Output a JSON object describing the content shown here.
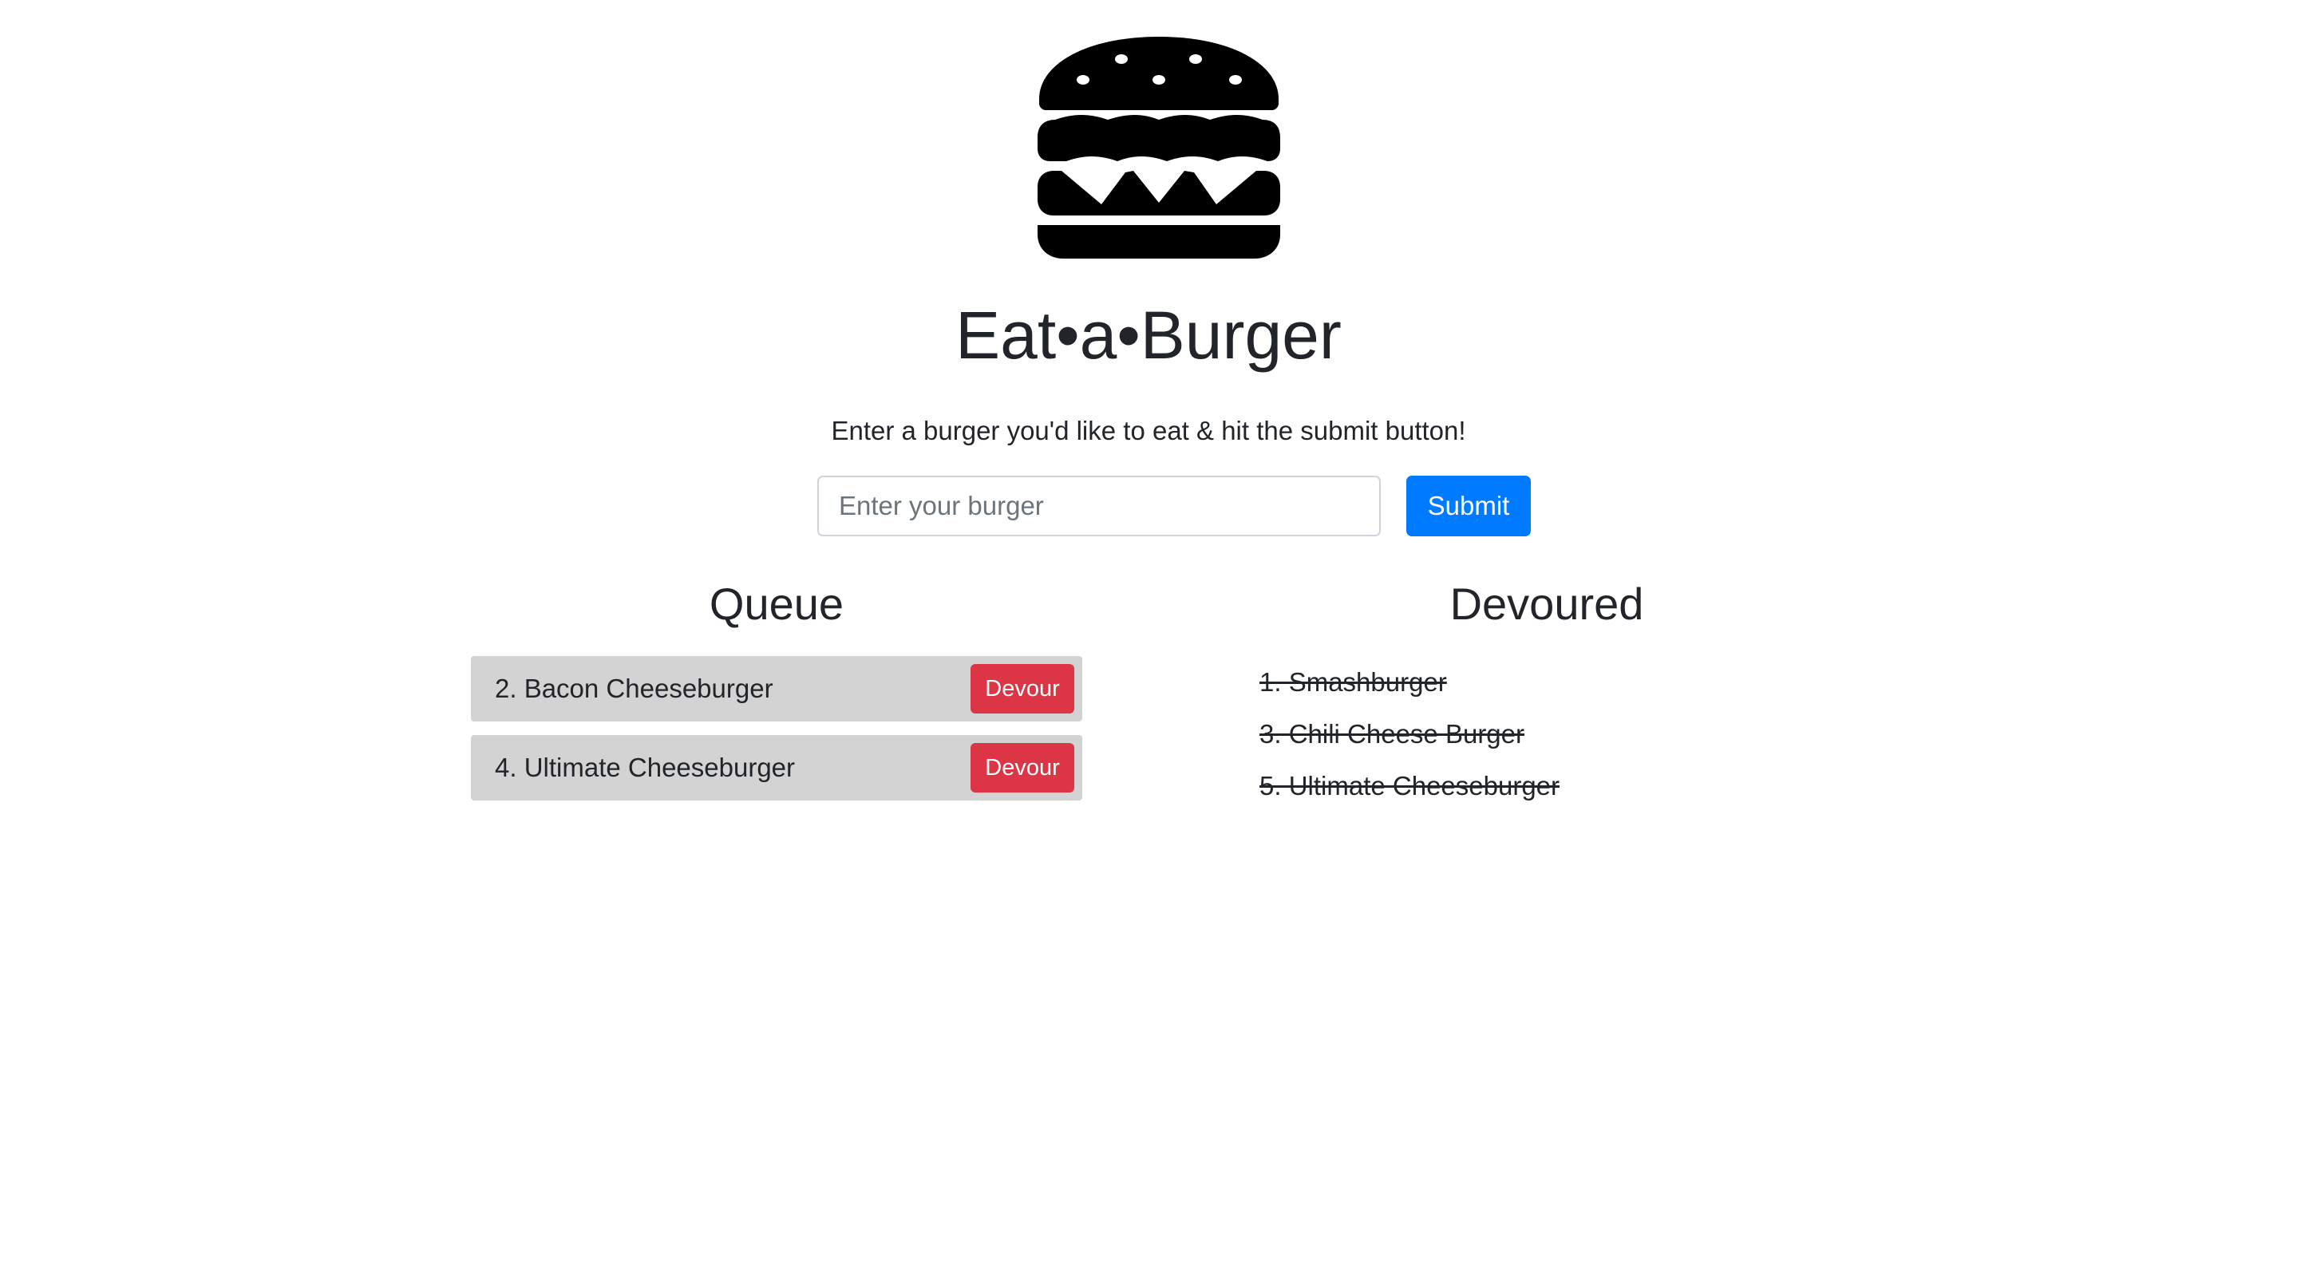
{
  "header": {
    "logo_icon": "burger-icon",
    "title": "Eat•a•Burger",
    "instructions": "Enter a burger you'd like to eat & hit the submit button!"
  },
  "form": {
    "placeholder": "Enter your burger",
    "value": "",
    "submit_label": "Submit"
  },
  "queue": {
    "heading": "Queue",
    "items": [
      {
        "label": "2. Bacon Cheeseburger",
        "action_label": "Devour"
      },
      {
        "label": "4. Ultimate Cheeseburger",
        "action_label": "Devour"
      }
    ]
  },
  "devoured": {
    "heading": "Devoured",
    "items": [
      {
        "label": "1. Smashburger"
      },
      {
        "label": "3. Chili Cheese Burger"
      },
      {
        "label": "5. Ultimate Cheeseburger"
      }
    ]
  },
  "colors": {
    "primary": "#007bff",
    "danger": "#dc3545",
    "queue_item_bg": "#d3d3d3",
    "text": "#212529"
  }
}
